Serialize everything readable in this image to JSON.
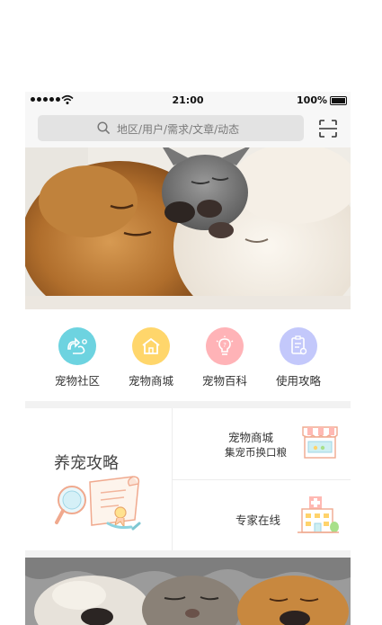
{
  "status_bar": {
    "time": "21:00",
    "battery": "100%"
  },
  "search": {
    "placeholder": "地区/用户/需求/文章/动态"
  },
  "categories": [
    {
      "label": "宠物社区",
      "icon": "community-icon",
      "color": "#6dd3e0"
    },
    {
      "label": "宠物商城",
      "icon": "shop-icon",
      "color": "#ffd66b"
    },
    {
      "label": "宠物百科",
      "icon": "bulb-icon",
      "color": "#ffb3b7"
    },
    {
      "label": "使用攻略",
      "icon": "guide-doc-icon",
      "color": "#c3c8fb"
    }
  ],
  "cards": {
    "guide": {
      "title": "养宠攻略"
    },
    "shop": {
      "title": "宠物商城",
      "subtitle": "集宠币换口粮"
    },
    "expert": {
      "title": "专家在线"
    }
  }
}
